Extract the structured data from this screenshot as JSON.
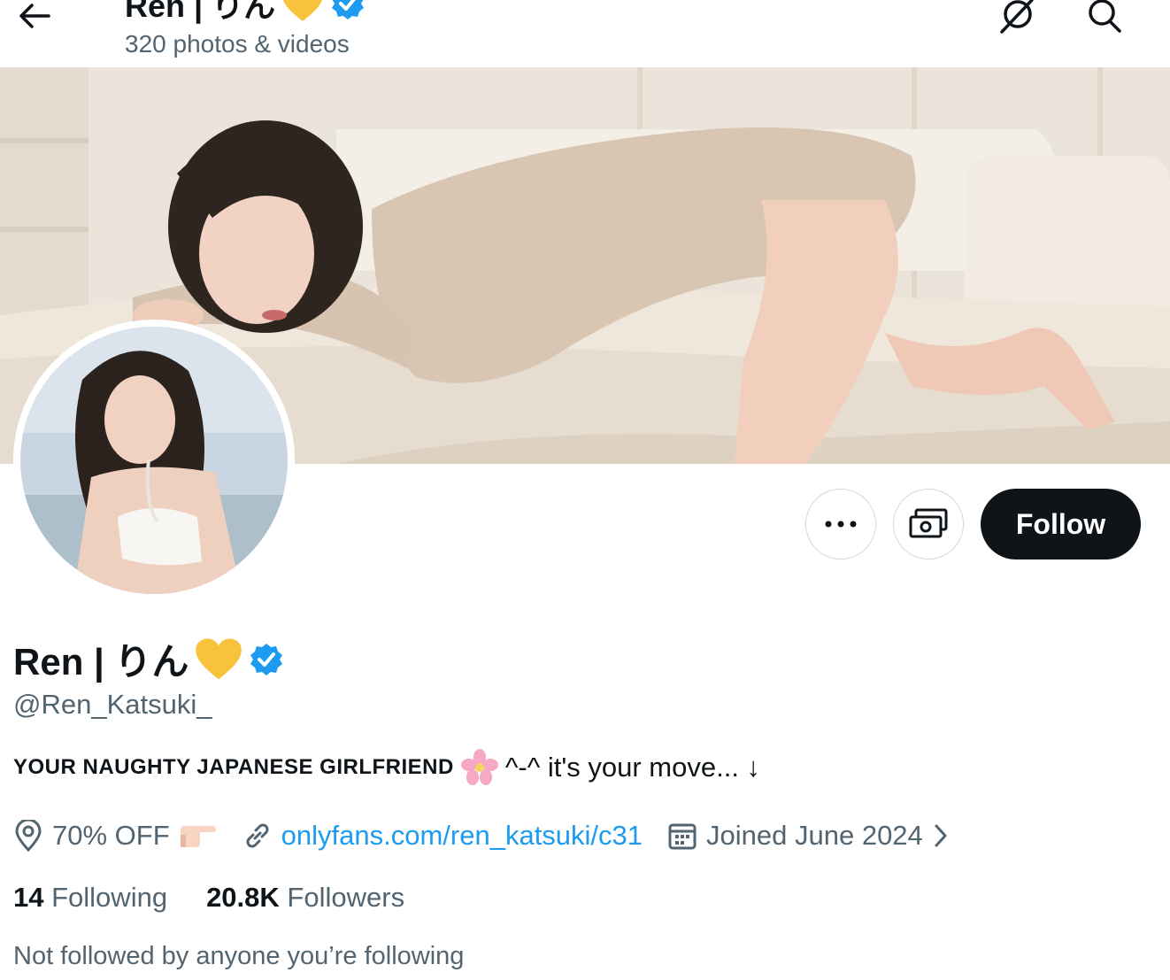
{
  "header": {
    "title": "Ren | りん",
    "subtitle": "320 photos & videos"
  },
  "profile": {
    "name": "Ren | りん",
    "handle": "@Ren_Katsuki_",
    "bio_caps": "YOUR NAUGHTY JAPANESE GIRLFRIEND",
    "bio_rest": "^-^ it's your move... ↓",
    "location": "70% OFF",
    "link": "onlyfans.com/ren_katsuki/c31",
    "joined": "Joined June 2024"
  },
  "stats": {
    "following_count": "14",
    "following_label": "Following",
    "followers_count": "20.8K",
    "followers_label": "Followers"
  },
  "not_followed_text": "Not followed by anyone you’re following",
  "actions": {
    "follow_label": "Follow"
  },
  "icons": {
    "back": "arrow-left-icon",
    "grok": "grok-icon",
    "search": "search-icon",
    "more": "more-icon",
    "subscribe": "money-icon",
    "verified": "verified-badge-icon",
    "heart": "yellow-heart-icon",
    "flower": "cherry-blossom-icon",
    "pointing": "pointing-hand-icon",
    "location": "location-pin-icon",
    "link": "link-icon",
    "calendar": "calendar-icon",
    "chevron": "chevron-right-icon"
  },
  "colors": {
    "accent": "#1d9bf0",
    "text": "#0f1419",
    "muted": "#536471",
    "heart": "#f9c23c",
    "follow_bg": "#0f1419"
  }
}
